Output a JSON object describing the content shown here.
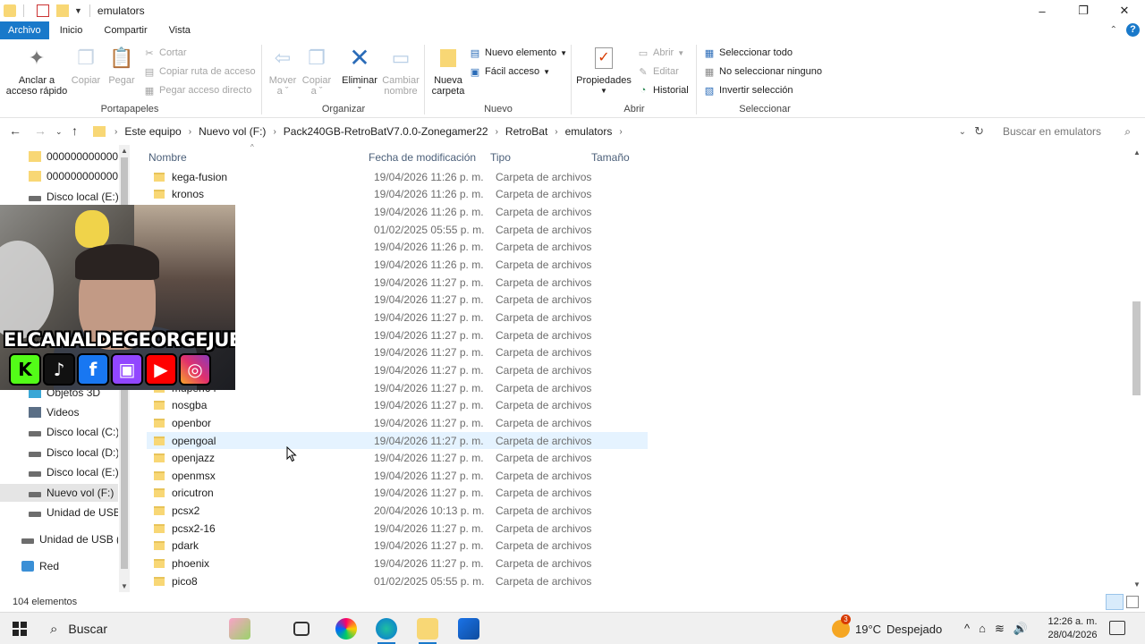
{
  "window": {
    "title": "emulators",
    "controls": [
      "–",
      "❐",
      "✕"
    ]
  },
  "ribbon_tabs": [
    "Archivo",
    "Inicio",
    "Compartir",
    "Vista"
  ],
  "ribbon": {
    "portapapeles": {
      "label": "Portapapeles",
      "anclar": "Anclar a\nacceso rápido",
      "anclar_l1": "Anclar a",
      "anclar_l2": "acceso rápido",
      "copiar": "Copiar",
      "pegar": "Pegar",
      "cortar": "Cortar",
      "copiar_ruta": "Copiar ruta de acceso",
      "pegar_acceso": "Pegar acceso directo"
    },
    "organizar": {
      "label": "Organizar",
      "mover_l1": "Mover",
      "mover_l2": "a ˇ",
      "copiar_l1": "Copiar",
      "copiar_l2": "a ˇ",
      "eliminar": "Eliminar",
      "eliminar_caret": "ˇ",
      "cambiar_l1": "Cambiar",
      "cambiar_l2": "nombre"
    },
    "nuevo": {
      "label": "Nuevo",
      "carpeta_l1": "Nueva",
      "carpeta_l2": "carpeta",
      "nuevo_elemento": "Nuevo elemento",
      "facil_acceso": "Fácil acceso"
    },
    "abrir": {
      "label": "Abrir",
      "propiedades": "Propiedades",
      "abrir": "Abrir",
      "editar": "Editar",
      "historial": "Historial"
    },
    "seleccionar": {
      "label": "Seleccionar",
      "todo": "Seleccionar todo",
      "ninguno": "No seleccionar ninguno",
      "invertir": "Invertir selección"
    }
  },
  "address": {
    "crumbs": [
      "Este equipo",
      "Nuevo vol (F:)",
      "Pack240GB-RetroBatV7.0.0-Zonegamer22",
      "RetroBat",
      "emulators"
    ],
    "search_placeholder": "Buscar en emulators"
  },
  "nav_pane": [
    {
      "label": "00000000000000000",
      "icon": "folder"
    },
    {
      "label": "00000000000000000",
      "icon": "folder"
    },
    {
      "label": "Disco local (E:)",
      "icon": "drive"
    },
    {
      "label": "Objetos 3D",
      "icon": "3d"
    },
    {
      "label": "Videos",
      "icon": "video"
    },
    {
      "label": "Disco local (C:)",
      "icon": "drive"
    },
    {
      "label": "Disco local (D:)",
      "icon": "drive"
    },
    {
      "label": "Disco local (E:)",
      "icon": "drive"
    },
    {
      "label": "Nuevo vol (F:)",
      "icon": "drive",
      "selected": true
    },
    {
      "label": "Unidad de USB (G",
      "icon": "drive"
    },
    {
      "label": "Unidad de USB (G",
      "icon": "drive"
    },
    {
      "label": "Red",
      "icon": "net"
    }
  ],
  "columns": {
    "name": "Nombre",
    "date": "Fecha de modificación",
    "type": "Tipo",
    "size": "Tamaño"
  },
  "files": [
    {
      "name": "kega-fusion",
      "date": "19/04/2026 11:26 p. m.",
      "type": "Carpeta de archivos"
    },
    {
      "name": "kronos",
      "date": "19/04/2026 11:26 p. m.",
      "type": "Carpeta de archivos"
    },
    {
      "name": "",
      "date": "19/04/2026 11:26 p. m.",
      "type": "Carpeta de archivos"
    },
    {
      "name": "",
      "date": "01/02/2025 05:55 p. m.",
      "type": "Carpeta de archivos"
    },
    {
      "name": "",
      "date": "19/04/2026 11:26 p. m.",
      "type": "Carpeta de archivos"
    },
    {
      "name": "",
      "date": "19/04/2026 11:26 p. m.",
      "type": "Carpeta de archivos"
    },
    {
      "name": "",
      "date": "19/04/2026 11:27 p. m.",
      "type": "Carpeta de archivos"
    },
    {
      "name": "",
      "date": "19/04/2026 11:27 p. m.",
      "type": "Carpeta de archivos"
    },
    {
      "name": "",
      "date": "19/04/2026 11:27 p. m.",
      "type": "Carpeta de archivos"
    },
    {
      "name": "",
      "date": "19/04/2026 11:27 p. m.",
      "type": "Carpeta de archivos"
    },
    {
      "name": "",
      "date": "19/04/2026 11:27 p. m.",
      "type": "Carpeta de archivos"
    },
    {
      "name": "",
      "date": "19/04/2026 11:27 p. m.",
      "type": "Carpeta de archivos"
    },
    {
      "name": "mupen64",
      "date": "19/04/2026 11:27 p. m.",
      "type": "Carpeta de archivos"
    },
    {
      "name": "nosgba",
      "date": "19/04/2026 11:27 p. m.",
      "type": "Carpeta de archivos"
    },
    {
      "name": "openbor",
      "date": "19/04/2026 11:27 p. m.",
      "type": "Carpeta de archivos"
    },
    {
      "name": "opengoal",
      "date": "19/04/2026 11:27 p. m.",
      "type": "Carpeta de archivos",
      "hover": true
    },
    {
      "name": "openjazz",
      "date": "19/04/2026 11:27 p. m.",
      "type": "Carpeta de archivos"
    },
    {
      "name": "openmsx",
      "date": "19/04/2026 11:27 p. m.",
      "type": "Carpeta de archivos"
    },
    {
      "name": "oricutron",
      "date": "19/04/2026 11:27 p. m.",
      "type": "Carpeta de archivos"
    },
    {
      "name": "pcsx2",
      "date": "20/04/2026 10:13 p. m.",
      "type": "Carpeta de archivos"
    },
    {
      "name": "pcsx2-16",
      "date": "19/04/2026 11:27 p. m.",
      "type": "Carpeta de archivos"
    },
    {
      "name": "pdark",
      "date": "19/04/2026 11:27 p. m.",
      "type": "Carpeta de archivos"
    },
    {
      "name": "phoenix",
      "date": "19/04/2026 11:27 p. m.",
      "type": "Carpeta de archivos"
    },
    {
      "name": "pico8",
      "date": "01/02/2025 05:55 p. m.",
      "type": "Carpeta de archivos"
    }
  ],
  "status": {
    "count": "104 elementos"
  },
  "overlay": {
    "channel": "ELCANALDEGEORGEJUEGA",
    "socials": [
      "K",
      "♪",
      "f",
      "▣",
      "▶",
      "◎"
    ]
  },
  "taskbar": {
    "search": "Buscar",
    "weather_temp": "19°C",
    "weather_desc": "Despejado",
    "weather_badge": "3",
    "time": "12:26 a. m.",
    "date": "28/04/2026",
    "tray_icons": [
      "^",
      "⌂",
      "≋",
      "🔊"
    ]
  },
  "colors": {
    "accent": "#1979ca",
    "folder": "#f8d775",
    "hover_row": "#e5f3ff"
  }
}
